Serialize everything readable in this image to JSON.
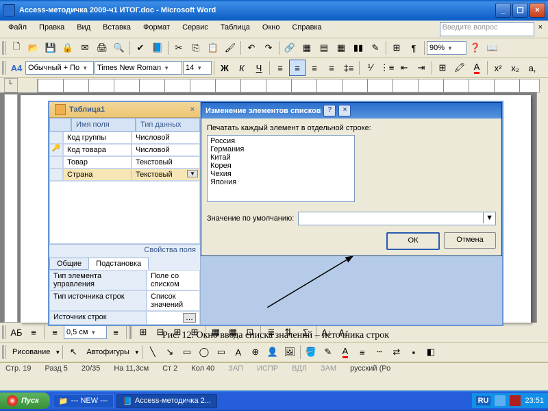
{
  "title": "Access-методичка 2009-ч1 ИТОГ.doc - Microsoft Word",
  "menu": [
    "Файл",
    "Правка",
    "Вид",
    "Вставка",
    "Формат",
    "Сервис",
    "Таблица",
    "Окно",
    "Справка"
  ],
  "ask_placeholder": "Введите вопрос",
  "zoom": "90%",
  "spelling_lang": "АБ",
  "style": "Обычный + По",
  "font": "Times New Roman",
  "font_size": "14",
  "line_spacing": "0,5 см",
  "draw_label": "Рисование",
  "autoshapes": "Автофигуры",
  "access": {
    "tab_title": "Таблица1",
    "col1": "Имя поля",
    "col2": "Тип данных",
    "rows": [
      {
        "key": "",
        "f": "Код группы",
        "t": "Числовой"
      },
      {
        "key": "🔑",
        "f": "Код товара",
        "t": "Числовой"
      },
      {
        "key": "",
        "f": "Товар",
        "t": "Текстовый"
      },
      {
        "key": "",
        "f": "Страна",
        "t": "Текстовый",
        "sel": true,
        "dd": true
      }
    ],
    "props_title": "Свойства поля",
    "tab_general": "Общие",
    "tab_lookup": "Подстановка",
    "prop_rows": [
      {
        "l": "Тип элемента управления",
        "v": "Поле со списком"
      },
      {
        "l": "Тип источника строк",
        "v": "Список значений"
      },
      {
        "l": "Источник строк",
        "v": "",
        "btn": true
      }
    ]
  },
  "dialog": {
    "title": "Изменение элементов списков",
    "instr": "Печатать каждый элемент в отдельной строке:",
    "items": [
      "Россия",
      "Германия",
      "Китай",
      "Корея",
      "Чехия",
      "Япония"
    ],
    "def_label": "Значение по умолчанию:",
    "ok": "ОК",
    "cancel": "Отмена"
  },
  "caption": "Рис. 12. Окно ввода списка значений – источника строк",
  "status": {
    "page": "Стр. 19",
    "sect": "Разд 5",
    "pages": "20/35",
    "at": "На 11,3см",
    "line": "Ст 2",
    "col": "Кол 40",
    "rec": "ЗАП",
    "trk": "ИСПР",
    "ext": "ВДЛ",
    "ovr": "ЗАМ",
    "lang": "русский (Ро"
  },
  "taskbar": {
    "start": "Пуск",
    "items": [
      "--- NEW ---",
      "Access-методичка 2..."
    ],
    "lang": "RU",
    "time": "23:51"
  }
}
